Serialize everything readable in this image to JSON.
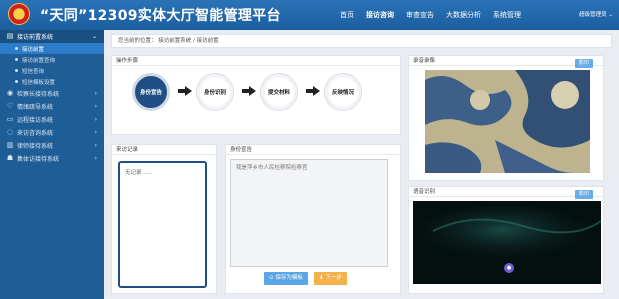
{
  "header": {
    "title": "“天同”12309实体大厅智能管理平台",
    "nav": [
      "首页",
      "接访咨询",
      "审查宣告",
      "大数据分析",
      "系统管理"
    ],
    "active_nav": 1,
    "user": "超级管理员"
  },
  "sidebar": {
    "groups": [
      {
        "label": "接访前置系统",
        "icon": "id-card-icon",
        "open": true
      },
      {
        "label": "检察长接待系统",
        "icon": "eye-icon"
      },
      {
        "label": "情绪疏导系统",
        "icon": "heart-icon"
      },
      {
        "label": "远程接访系统",
        "icon": "monitor-icon"
      },
      {
        "label": "来访咨询系统",
        "icon": "chat-icon"
      },
      {
        "label": "律师接待系统",
        "icon": "book-icon"
      },
      {
        "label": "集体访接待系统",
        "icon": "group-icon"
      }
    ],
    "subitems": [
      {
        "label": "接访前置",
        "active": true
      },
      {
        "label": "接访前置查询"
      },
      {
        "label": "短信查询"
      },
      {
        "label": "短信模板设置"
      }
    ]
  },
  "breadcrumb": "您当前的位置：  接访前置系统 / 接访前置",
  "steps_panel": {
    "title": "操作步骤",
    "steps": [
      "身份宣告",
      "身份识别",
      "提交材料",
      "反映情况"
    ]
  },
  "visit_record": {
    "title": "来访记录",
    "placeholder": "无记录......"
  },
  "identity_notice": {
    "title": "身份宣告",
    "text": "我是萍乡市人民检察院检察官",
    "save_button": "保存为模板",
    "next_button": "下一步"
  },
  "recording": {
    "title": "录音录像",
    "button": "影印"
  },
  "face_recognition": {
    "title": "语音识别",
    "button": "影印"
  },
  "colors": {
    "header": "#1c5ea0",
    "sidebar": "#1f5d97",
    "active_step": "#1f4f84",
    "save_button": "#5aa6e6",
    "next_button": "#f2b14b"
  }
}
